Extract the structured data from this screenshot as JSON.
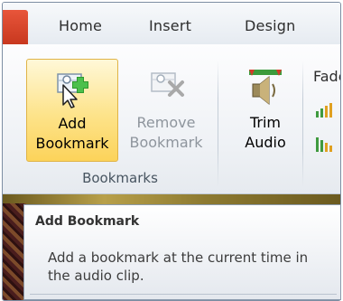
{
  "tabs": [
    "Home",
    "Insert",
    "Design"
  ],
  "ribbon": {
    "add_bookmark": {
      "line1": "Add",
      "line2": "Bookmark"
    },
    "remove_bookmark": {
      "line1": "Remove",
      "line2": "Bookmark"
    },
    "trim_audio": {
      "line1": "Trim",
      "line2": "Audio"
    },
    "group_label": "Bookmarks",
    "fade_label": "Fade"
  },
  "tooltip": {
    "title": "Add Bookmark",
    "body": "Add a bookmark at the current time in the audio clip."
  }
}
